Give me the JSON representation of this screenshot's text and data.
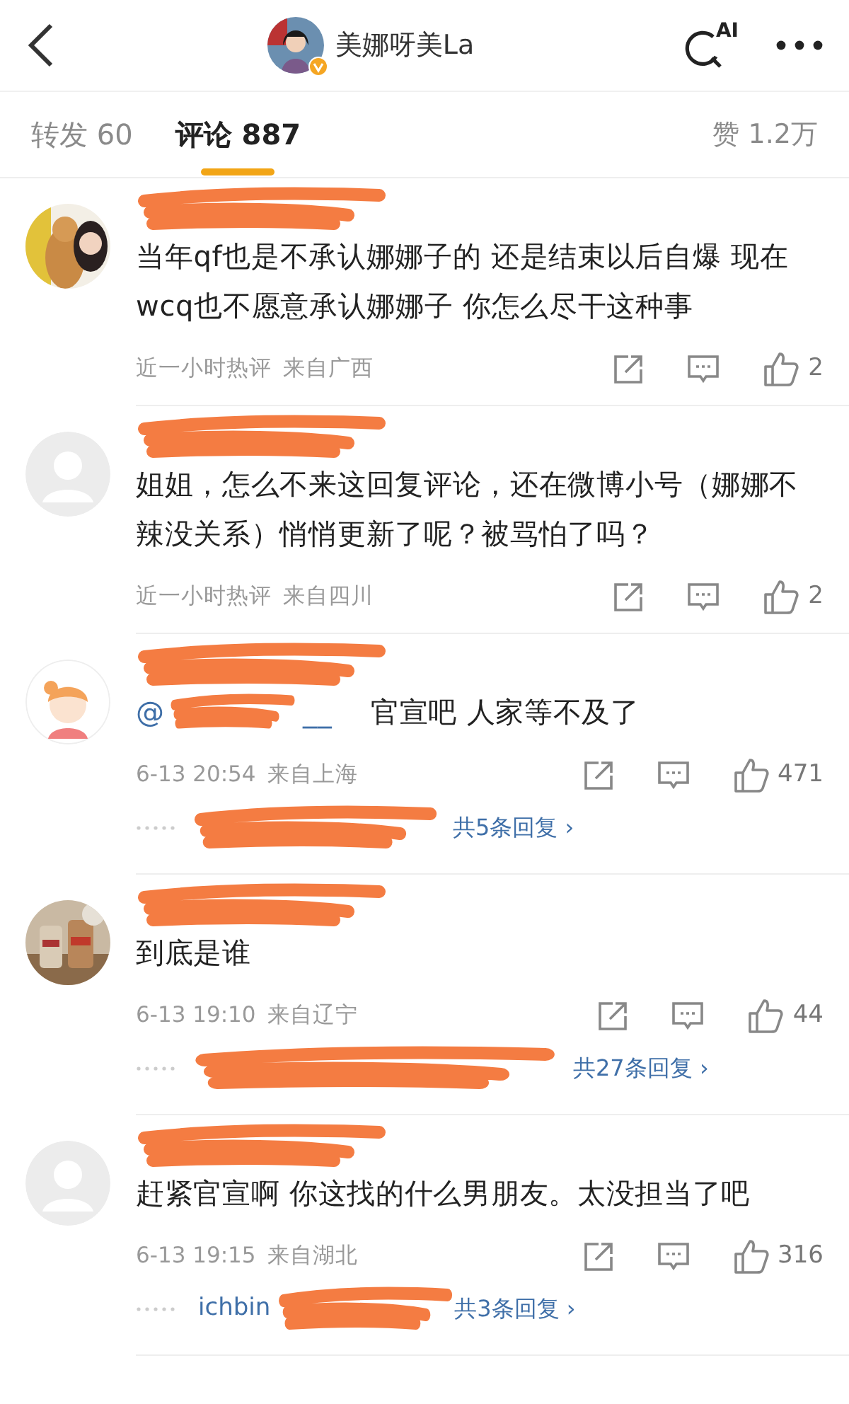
{
  "header": {
    "title": "美娜呀美La",
    "verified": true,
    "search_badge": "AI"
  },
  "tabs": [
    {
      "label": "转发 60",
      "selected": false
    },
    {
      "label": "评论 887",
      "selected": true
    }
  ],
  "likes_tab": "赞 1.2万",
  "comments": [
    {
      "redacted_name": true,
      "text": "当年qf也是不承认娜娜子的 还是结束以后自爆 现在wcq也不愿意承认娜娜子 你怎么尽干这种事",
      "time": "近一小时热评",
      "location": "来自广西",
      "likes": "2"
    },
    {
      "avatar": {
        "kind": "default"
      },
      "redacted_name": true,
      "text": "姐姐，怎么不来这回复评论，还在微博小号（娜娜不辣没关系）悄悄更新了呢？被骂怕了吗？",
      "time": "近一小时热评",
      "location": "来自四川",
      "likes": "2"
    },
    {
      "avatar": {
        "kind": "cartoon"
      },
      "redacted_name": true,
      "mention": "@",
      "mention_tail": "__",
      "text": "官宣吧 人家等不及了",
      "time": "6-13 20:54",
      "location": "来自上海",
      "likes": "471",
      "replies": {
        "count": "共5条回复 ›"
      }
    },
    {
      "redacted_name": true,
      "text": "到底是谁",
      "time": "6-13 19:10",
      "location": "来自辽宁",
      "likes": "44",
      "replies": {
        "count": "共27条回复 ›"
      }
    },
    {
      "avatar": {
        "kind": "default"
      },
      "redacted_name": true,
      "text": "赶紧官宣啊 你这找的什么男朋友。太没担当了吧",
      "time": "6-13 19:15",
      "location": "来自湖北",
      "likes": "316",
      "replies": {
        "prefix": "ichbin",
        "count": "共3条回复 ›"
      }
    }
  ]
}
